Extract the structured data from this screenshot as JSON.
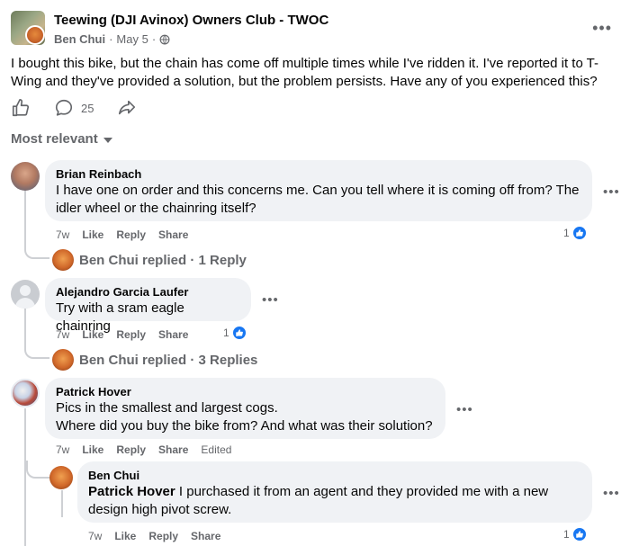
{
  "post": {
    "group_name": "Teewing (DJI Avinox) Owners Club - TWOC",
    "author": "Ben Chui",
    "sep": "·",
    "date": "May 5",
    "body": "I bought this bike, but the chain has come off multiple times while I've ridden it. I've reported it to T-Wing and they've provided a solution, but the problem persists. Have any of you experienced this?",
    "comment_count": "25"
  },
  "sort": {
    "label": "Most relevant"
  },
  "actions": {
    "like": "Like",
    "reply": "Reply",
    "share": "Share",
    "edited": "Edited"
  },
  "comments": [
    {
      "author": "Brian Reinbach",
      "text": "I have one on order and this concerns me. Can you tell where it is coming off from? The idler wheel or the chainring itself?",
      "time": "7w",
      "reactions": "1",
      "replies_link": "Ben Chui replied · 1 Reply"
    },
    {
      "author": "Alejandro Garcia Laufer",
      "text": "Try with a sram eagle chainring",
      "time": "7w",
      "reactions": "1",
      "replies_link": "Ben Chui replied · 3 Replies"
    },
    {
      "author": "Patrick Hover",
      "text_line1": "Pics in the smallest and largest cogs.",
      "text_line2": "Where did you buy the bike from? And what was their solution?",
      "time": "7w"
    }
  ],
  "reply": {
    "author": "Ben Chui",
    "tag": "Patrick Hover",
    "text": "I purchased it from an agent and they provided me with a new design high pivot screw.",
    "time": "7w",
    "reactions": "1"
  },
  "colors": {
    "accent": "#1877f2",
    "secondary_text": "#65676b",
    "bubble": "#f0f2f5"
  },
  "icons": [
    "globe-icon",
    "like-icon",
    "comment-icon",
    "share-icon",
    "more-icon",
    "caret-down-icon",
    "like-badge-icon"
  ]
}
